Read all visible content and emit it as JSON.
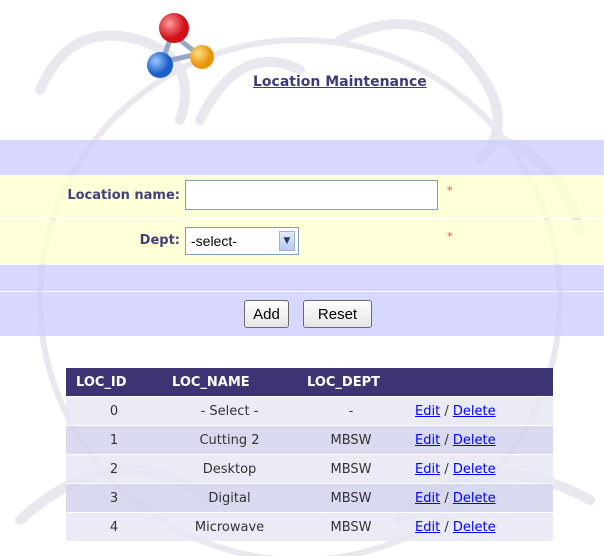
{
  "page": {
    "title": "Location Maintenance"
  },
  "form": {
    "location_label": "Location name:",
    "location_value": "",
    "dept_label": "Dept:",
    "dept_selected": "-select-",
    "required_mark": "*",
    "add_label": "Add",
    "reset_label": "Reset"
  },
  "table": {
    "headers": [
      "LOC_ID",
      "LOC_NAME",
      "LOC_DEPT",
      ""
    ],
    "rows": [
      {
        "id": "0",
        "name": "- Select -",
        "dept": "-",
        "edit": "Edit",
        "sep": "/",
        "delete": "Delete"
      },
      {
        "id": "1",
        "name": "Cutting 2",
        "dept": "MBSW",
        "edit": "Edit",
        "sep": "/",
        "delete": "Delete"
      },
      {
        "id": "2",
        "name": "Desktop",
        "dept": "MBSW",
        "edit": "Edit",
        "sep": "/",
        "delete": "Delete"
      },
      {
        "id": "3",
        "name": "Digital",
        "dept": "MBSW",
        "edit": "Edit",
        "sep": "/",
        "delete": "Delete"
      },
      {
        "id": "4",
        "name": "Microwave",
        "dept": "MBSW",
        "edit": "Edit",
        "sep": "/",
        "delete": "Delete"
      }
    ]
  },
  "icons": {
    "logo": "molecule-logo-icon",
    "select_arrow": "chevron-down-icon"
  },
  "colors": {
    "header_bg": "#3d3573",
    "band_blue": "#ccccff",
    "band_yellow": "#ffffce",
    "link": "#0000ff",
    "required": "#ff4040"
  }
}
